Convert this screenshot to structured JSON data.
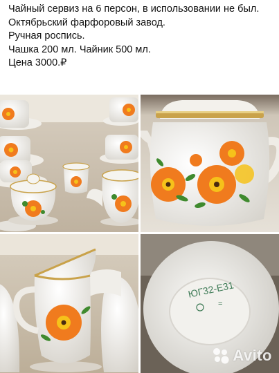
{
  "description": {
    "line1": "Чайный сервиз на 6 персон, в использовании не был.",
    "line2": "Октябрьский фарфоровый завод.",
    "line3": "Ручная роспись.",
    "line4": "Чашка 200 мл. Чайник 500 мл.",
    "line5": "Цена 3000.₽"
  },
  "photos": {
    "photo1": {
      "alt": "set overview"
    },
    "photo2": {
      "alt": "teapot"
    },
    "photo3": {
      "alt": "creamer"
    },
    "photo4": {
      "alt": "teapot bottom stamp",
      "stamp_text": "ЮГ32-Е31",
      "stamp_mark": "="
    }
  },
  "watermark": {
    "text": "Avito"
  },
  "colors": {
    "porcelain": "#f4f3ef",
    "flower_orange": "#f07b1e",
    "flower_yellow": "#f6c21a",
    "leaf": "#3f8a2e",
    "gold": "#c9a24a"
  }
}
